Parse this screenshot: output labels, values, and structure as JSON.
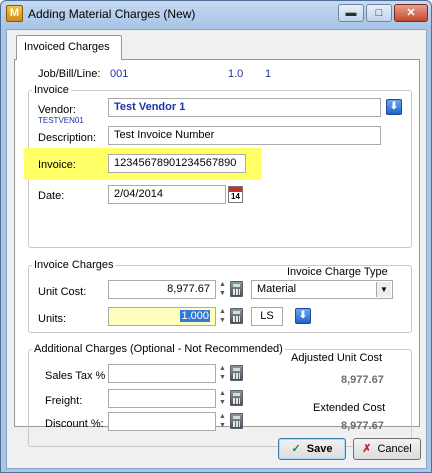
{
  "window": {
    "title": "Adding Material Charges (New)",
    "app_icon_letter": "M"
  },
  "tab": {
    "label": "Invoiced Charges"
  },
  "job": {
    "label": "Job/Bill/Line:",
    "job": "001",
    "bill": "1.0",
    "line": "1"
  },
  "invoice_group": {
    "title": "Invoice",
    "vendor_label": "Vendor:",
    "vendor_code": "TESTVEN01",
    "vendor_value": "Test Vendor 1",
    "description_label": "Description:",
    "description_value": "Test Invoice Number",
    "invoice_label": "Invoice:",
    "invoice_value": "12345678901234567890",
    "date_label": "Date:",
    "date_value": "2/04/2014",
    "calendar_day": "14"
  },
  "charges_group": {
    "title": "Invoice Charges",
    "unit_cost_label": "Unit Cost:",
    "unit_cost_value": "8,977.67",
    "type_label": "Invoice Charge Type",
    "type_value": "Material",
    "units_label": "Units:",
    "units_value": "1.000",
    "uom_value": "LS"
  },
  "additional_group": {
    "title": "Additional Charges (Optional - Not Recommended)",
    "sales_tax_label": "Sales Tax %",
    "freight_label": "Freight:",
    "discount_label": "Discount %:",
    "adjusted_label": "Adjusted Unit Cost",
    "adjusted_value": "8,977.67",
    "extended_label": "Extended Cost",
    "extended_value": "8,977.67"
  },
  "buttons": {
    "save": "Save",
    "cancel": "Cancel"
  },
  "colors": {
    "highlight": "#ffff66",
    "value_blue": "#1a33a8",
    "units_bg": "#ffffc0"
  }
}
